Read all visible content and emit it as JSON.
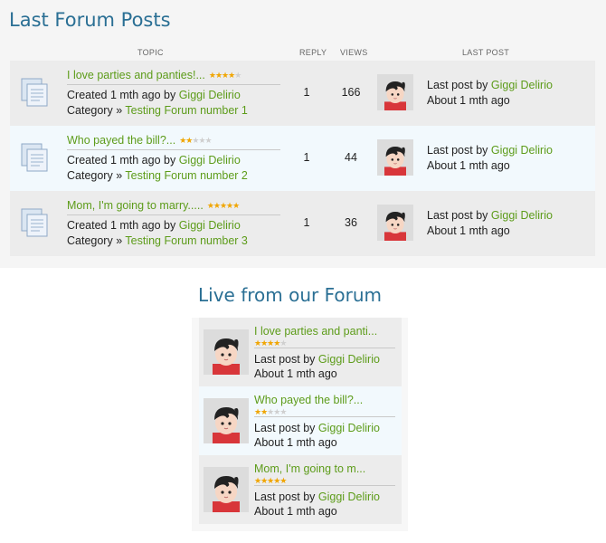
{
  "last_posts": {
    "title": "Last Forum Posts",
    "columns": {
      "topic": "TOPIC",
      "reply": "REPLY",
      "views": "VIEWS",
      "last_post": "LAST POST"
    },
    "rows": [
      {
        "title": "I love parties and panties!...",
        "rating": 4,
        "created_prefix": "Created 1 mth ago by ",
        "author": "Giggi Delirio",
        "category_prefix": "Category » ",
        "category": "Testing Forum number 1",
        "replies": "1",
        "views": "166",
        "last_post_prefix": "Last post by ",
        "last_post_author": "Giggi Delirio",
        "last_post_time": "About 1 mth ago"
      },
      {
        "title": "Who payed the bill?...",
        "rating": 2,
        "created_prefix": "Created 1 mth ago by ",
        "author": "Giggi Delirio",
        "category_prefix": "Category » ",
        "category": "Testing Forum number 2",
        "replies": "1",
        "views": "44",
        "last_post_prefix": "Last post by ",
        "last_post_author": "Giggi Delirio",
        "last_post_time": "About 1 mth ago"
      },
      {
        "title": "Mom, I'm going to marry.....",
        "rating": 5,
        "created_prefix": "Created 1 mth ago by ",
        "author": "Giggi Delirio",
        "category_prefix": "Category » ",
        "category": "Testing Forum number 3",
        "replies": "1",
        "views": "36",
        "last_post_prefix": "Last post by ",
        "last_post_author": "Giggi Delirio",
        "last_post_time": "About 1 mth ago"
      }
    ]
  },
  "live": {
    "title": "Live from our Forum",
    "rows": [
      {
        "title": "I love parties and panti...",
        "rating": 4,
        "last_post_prefix": "Last post by ",
        "last_post_author": "Giggi Delirio",
        "last_post_time": "About 1 mth ago"
      },
      {
        "title": "Who payed the bill?...",
        "rating": 2,
        "last_post_prefix": "Last post by ",
        "last_post_author": "Giggi Delirio",
        "last_post_time": "About 1 mth ago"
      },
      {
        "title": "Mom, I'm going to m...",
        "rating": 5,
        "last_post_prefix": "Last post by ",
        "last_post_author": "Giggi Delirio",
        "last_post_time": "About 1 mth ago"
      }
    ]
  },
  "icons": {
    "topic": "document-stack-icon",
    "avatar": "user-avatar-icon",
    "star": "star-icon"
  },
  "colors": {
    "title": "#2a6f94",
    "link": "#5d9c1a",
    "star": "#f0a500",
    "row_alt": "#f2f9fd",
    "row_plain": "#ececec"
  }
}
